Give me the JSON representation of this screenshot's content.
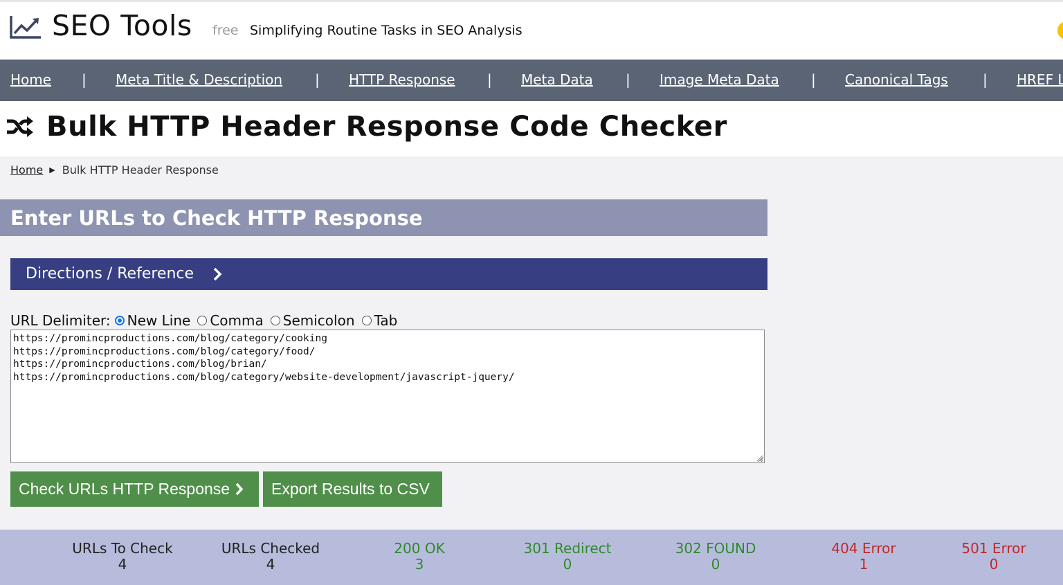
{
  "header": {
    "logo_text": "SEO Tools",
    "free_tag": "free",
    "tagline": "Simplifying Routine Tasks in SEO Analysis",
    "logo_icon": "chart-line-icon"
  },
  "nav": {
    "items": [
      {
        "label": "Home"
      },
      {
        "label": "Meta Title & Description"
      },
      {
        "label": "HTTP Response"
      },
      {
        "label": "Meta Data"
      },
      {
        "label": "Image Meta Data"
      },
      {
        "label": "Canonical Tags"
      },
      {
        "label": "HREF L"
      }
    ],
    "separator": "|"
  },
  "page": {
    "title": "Bulk HTTP Header Response Code Checker",
    "title_icon": "shuffle-icon"
  },
  "breadcrumb": {
    "home": "Home",
    "current": "Bulk HTTP Header Response"
  },
  "form": {
    "section_title": "Enter URLs to Check HTTP Response",
    "directions_label": "Directions / Reference",
    "delimiter_label": "URL Delimiter:",
    "delimiter_options": [
      {
        "label": "New Line",
        "checked": true
      },
      {
        "label": "Comma",
        "checked": false
      },
      {
        "label": "Semicolon",
        "checked": false
      },
      {
        "label": "Tab",
        "checked": false
      }
    ],
    "urls": "https://promincproductions.com/blog/category/cooking\nhttps://promincproductions.com/blog/category/food/\nhttps://promincproductions.com/blog/brian/\nhttps://promincproductions.com/blog/category/website-development/javascript-jquery/",
    "check_button": "Check URLs HTTP Response",
    "export_button": "Export Results to CSV"
  },
  "stats": [
    {
      "label": "URLs To Check",
      "value": "4",
      "tone": "dark"
    },
    {
      "label": "URLs Checked",
      "value": "4",
      "tone": "dark"
    },
    {
      "label": "200 OK",
      "value": "3",
      "tone": "green"
    },
    {
      "label": "301 Redirect",
      "value": "0",
      "tone": "green"
    },
    {
      "label": "302 FOUND",
      "value": "0",
      "tone": "green"
    },
    {
      "label": "404 Error",
      "value": "1",
      "tone": "red"
    },
    {
      "label": "501 Error",
      "value": "0",
      "tone": "red"
    }
  ],
  "colors": {
    "nav_bg": "#5b6474",
    "section_bar": "#8e93b2",
    "directions_bg": "#373f82",
    "button_green": "#4f8f4a",
    "stats_bg": "#b7bcdc",
    "ok_green": "#2f8a2a",
    "error_red": "#c0282a"
  }
}
